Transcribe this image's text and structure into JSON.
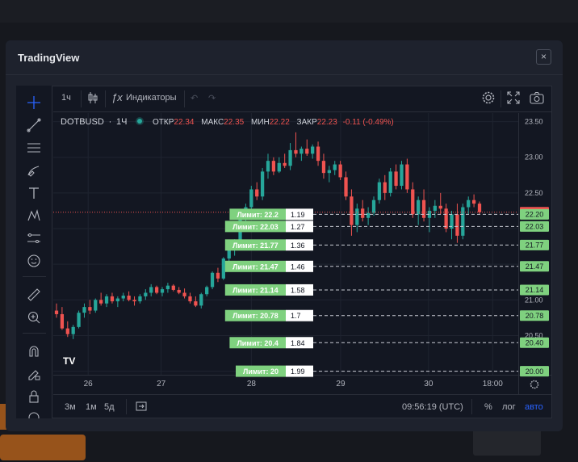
{
  "modal": {
    "title": "TradingView",
    "close_label": "×"
  },
  "toolbar": {
    "interval": "1ч",
    "indicators_label": "Индикаторы"
  },
  "legend": {
    "symbol": "DOTBUSD",
    "interval": "1Ч",
    "open_label": "ОТКР",
    "open": "22.34",
    "high_label": "МАКС",
    "high": "22.35",
    "low_label": "МИН",
    "low": "22.22",
    "close_label": "ЗАКР",
    "close": "22.23",
    "change": "-0.11 (-0.49%)"
  },
  "bottombar": {
    "range_3m": "3м",
    "range_1m": "1м",
    "range_5d": "5д",
    "time": "09:56:19 (UTC)",
    "percent": "%",
    "log": "лог",
    "auto": "авто"
  },
  "logo_text": "TV",
  "colors": {
    "up": "#26a69a",
    "down": "#ef5350",
    "limit_green": "#7fd17f",
    "background": "#131722"
  },
  "chart_data": {
    "type": "candlestick",
    "symbol": "DOTBUSD",
    "interval": "1Ч",
    "ylim": [
      19.95,
      23.62
    ],
    "y_ticks": [
      "23.50",
      "23.00",
      "22.50",
      "22.00",
      "21.50",
      "21.00",
      "20.50",
      "20.00"
    ],
    "x_ticks": [
      {
        "label": "26",
        "pos": 0.075
      },
      {
        "label": "27",
        "pos": 0.232
      },
      {
        "label": "28",
        "pos": 0.426
      },
      {
        "label": "29",
        "pos": 0.618
      },
      {
        "label": "30",
        "pos": 0.807
      },
      {
        "label": "18:00",
        "pos": 0.945
      }
    ],
    "candles": [
      [
        20.85,
        20.95,
        20.75,
        20.8
      ],
      [
        20.8,
        20.9,
        20.58,
        20.6
      ],
      [
        20.6,
        20.7,
        20.48,
        20.52
      ],
      [
        20.52,
        20.65,
        20.45,
        20.62
      ],
      [
        20.62,
        20.85,
        20.6,
        20.82
      ],
      [
        20.82,
        20.95,
        20.75,
        20.9
      ],
      [
        20.9,
        21.0,
        20.8,
        20.85
      ],
      [
        20.85,
        21.02,
        20.82,
        21.0
      ],
      [
        21.0,
        21.1,
        20.92,
        20.95
      ],
      [
        20.95,
        21.08,
        20.9,
        21.05
      ],
      [
        21.05,
        21.1,
        20.95,
        20.98
      ],
      [
        20.98,
        21.05,
        20.9,
        21.02
      ],
      [
        21.02,
        21.1,
        20.98,
        21.06
      ],
      [
        21.06,
        21.12,
        20.98,
        21.0
      ],
      [
        21.0,
        21.05,
        20.92,
        20.98
      ],
      [
        20.98,
        21.08,
        20.95,
        21.05
      ],
      [
        21.05,
        21.15,
        21.0,
        21.1
      ],
      [
        21.1,
        21.22,
        21.05,
        21.18
      ],
      [
        21.18,
        21.2,
        21.08,
        21.1
      ],
      [
        21.1,
        21.18,
        21.05,
        21.15
      ],
      [
        21.15,
        21.24,
        21.1,
        21.2
      ],
      [
        21.2,
        21.22,
        21.12,
        21.14
      ],
      [
        21.14,
        21.18,
        21.08,
        21.1
      ],
      [
        21.1,
        21.16,
        21.02,
        21.05
      ],
      [
        21.05,
        21.1,
        20.95,
        20.98
      ],
      [
        20.98,
        21.05,
        20.9,
        20.92
      ],
      [
        20.92,
        21.1,
        20.88,
        21.08
      ],
      [
        21.08,
        21.2,
        21.05,
        21.18
      ],
      [
        21.18,
        21.4,
        21.15,
        21.38
      ],
      [
        21.38,
        21.45,
        21.25,
        21.3
      ],
      [
        21.3,
        21.6,
        21.28,
        21.58
      ],
      [
        21.58,
        21.75,
        21.5,
        21.7
      ],
      [
        21.7,
        21.85,
        21.62,
        21.8
      ],
      [
        21.8,
        22.2,
        21.75,
        22.15
      ],
      [
        22.15,
        22.35,
        22.05,
        22.3
      ],
      [
        22.3,
        22.6,
        22.25,
        22.55
      ],
      [
        22.55,
        22.65,
        22.4,
        22.45
      ],
      [
        22.45,
        22.85,
        22.4,
        22.8
      ],
      [
        22.8,
        23.05,
        22.7,
        22.95
      ],
      [
        22.95,
        23.0,
        22.75,
        22.8
      ],
      [
        22.8,
        23.0,
        22.78,
        22.92
      ],
      [
        22.92,
        23.05,
        22.85,
        22.88
      ],
      [
        22.88,
        23.2,
        22.82,
        23.1
      ],
      [
        23.1,
        23.35,
        23.0,
        23.05
      ],
      [
        23.05,
        23.15,
        22.95,
        23.12
      ],
      [
        23.12,
        23.25,
        23.02,
        23.05
      ],
      [
        23.05,
        23.18,
        22.98,
        23.15
      ],
      [
        23.15,
        23.22,
        22.88,
        22.95
      ],
      [
        22.95,
        23.05,
        22.7,
        22.78
      ],
      [
        22.78,
        22.88,
        22.65,
        22.82
      ],
      [
        22.82,
        22.95,
        22.75,
        22.9
      ],
      [
        22.9,
        22.95,
        22.68,
        22.72
      ],
      [
        22.72,
        22.8,
        22.4,
        22.45
      ],
      [
        22.45,
        22.55,
        21.9,
        22.05
      ],
      [
        22.05,
        22.35,
        21.95,
        22.28
      ],
      [
        22.28,
        22.4,
        22.1,
        22.15
      ],
      [
        22.15,
        22.3,
        22.05,
        22.22
      ],
      [
        22.22,
        22.45,
        22.18,
        22.4
      ],
      [
        22.4,
        22.7,
        22.35,
        22.65
      ],
      [
        22.65,
        22.75,
        22.4,
        22.5
      ],
      [
        22.5,
        22.85,
        22.45,
        22.8
      ],
      [
        22.8,
        22.9,
        22.55,
        22.6
      ],
      [
        22.6,
        22.95,
        22.55,
        22.9
      ],
      [
        22.9,
        22.98,
        22.5,
        22.55
      ],
      [
        22.55,
        22.65,
        22.15,
        22.2
      ],
      [
        22.2,
        22.45,
        22.05,
        22.4
      ],
      [
        22.4,
        22.55,
        22.1,
        22.15
      ],
      [
        22.15,
        22.3,
        21.95,
        22.25
      ],
      [
        22.25,
        22.4,
        22.15,
        22.32
      ],
      [
        22.32,
        22.5,
        22.2,
        22.28
      ],
      [
        22.28,
        22.35,
        21.95,
        22.0
      ],
      [
        22.0,
        22.25,
        21.85,
        22.2
      ],
      [
        22.2,
        22.35,
        21.8,
        21.9
      ],
      [
        21.9,
        22.35,
        21.85,
        22.3
      ],
      [
        22.3,
        22.45,
        22.2,
        22.4
      ],
      [
        22.4,
        22.48,
        22.3,
        22.35
      ],
      [
        22.35,
        22.38,
        22.2,
        22.23
      ]
    ],
    "last_price": 22.23,
    "price_labels": [
      {
        "price": 22.23,
        "label": "22.23",
        "kind": "last"
      },
      {
        "price": 22.2,
        "label": "22.20",
        "kind": "limit"
      },
      {
        "price": 22.03,
        "label": "22.03",
        "kind": "limit"
      },
      {
        "price": 21.77,
        "label": "21.77",
        "kind": "limit"
      },
      {
        "price": 21.47,
        "label": "21.47",
        "kind": "limit"
      },
      {
        "price": 21.14,
        "label": "21.14",
        "kind": "limit"
      },
      {
        "price": 20.78,
        "label": "20.78",
        "kind": "limit"
      },
      {
        "price": 20.4,
        "label": "20.40",
        "kind": "limit"
      },
      {
        "price": 20.0,
        "label": "20.00",
        "kind": "limit"
      }
    ],
    "orders": [
      {
        "price": 22.2,
        "label": "Лимит: 22.2",
        "qty": "1.19"
      },
      {
        "price": 22.03,
        "label": "Лимит: 22.03",
        "qty": "1.27"
      },
      {
        "price": 21.77,
        "label": "Лимит: 21.77",
        "qty": "1.36"
      },
      {
        "price": 21.47,
        "label": "Лимит: 21.47",
        "qty": "1.46"
      },
      {
        "price": 21.14,
        "label": "Лимит: 21.14",
        "qty": "1.58"
      },
      {
        "price": 20.78,
        "label": "Лимит: 20.78",
        "qty": "1.7"
      },
      {
        "price": 20.4,
        "label": "Лимит: 20.4",
        "qty": "1.84"
      },
      {
        "price": 20,
        "label": "Лимит: 20",
        "qty": "1.99"
      }
    ]
  }
}
